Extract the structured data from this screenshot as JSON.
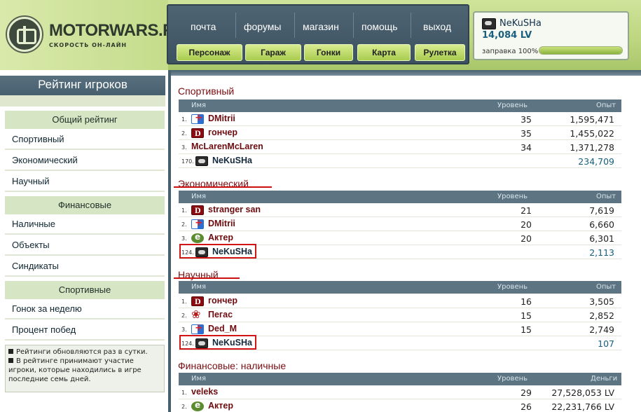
{
  "brand": {
    "name": "MOTORWARS.RU",
    "tagline": "СКОРОСТЬ ОН-ЛАЙН"
  },
  "topnav": {
    "links": [
      "почта",
      "форумы",
      "магазин",
      "помощь",
      "выход"
    ],
    "buttons": [
      "Персонаж",
      "Гараж",
      "Гонки",
      "Карта",
      "Рулетка"
    ]
  },
  "user": {
    "name": "NeKuSHa",
    "lv": "14,084 LV",
    "fuel_label": "заправка 100%",
    "fuel_percent": 100,
    "avatar_icon": "mask-icon"
  },
  "left": {
    "title": "Рейтинг игроков",
    "sections": [
      {
        "title": "Общий рейтинг",
        "items": [
          "Спортивный",
          "Экономический",
          "Научный"
        ]
      },
      {
        "title": "Финансовые",
        "items": [
          "Наличные",
          "Объекты",
          "Синдикаты"
        ]
      },
      {
        "title": "Спортивные",
        "items": [
          "Гонок за неделю",
          "Процент побед"
        ]
      }
    ],
    "notes": [
      "Рейтинги обновляются раз в сутки.",
      "В рейтинге принимают участие игроки, которые находились в игре последние семь дней."
    ]
  },
  "columns": {
    "name": "Имя",
    "level": "Уровень",
    "exp": "Опыт",
    "money": "Деньги"
  },
  "colors": {
    "accent": "#47606f",
    "title_red": "#7b0c10",
    "highlight_red": "#d21414"
  },
  "sections": [
    {
      "title": "Спортивный",
      "rows": [
        {
          "rank": "1.",
          "icon": "flag-icon",
          "name": "DMitrii",
          "level": "35",
          "value": "1,595,471"
        },
        {
          "rank": "2.",
          "icon": "d-icon",
          "name": "гончер",
          "level": "35",
          "value": "1,455,022"
        },
        {
          "rank": "3.",
          "icon": "",
          "name": "McLarenMcLaren",
          "level": "34",
          "value": "1,371,278"
        },
        {
          "rank": "170.",
          "icon": "mask-icon",
          "name": "NeKuSHa",
          "level": "",
          "value": "234,709"
        }
      ]
    },
    {
      "title": "Экономический",
      "rows": [
        {
          "rank": "1.",
          "icon": "d-icon",
          "name": "stranger san",
          "level": "21",
          "value": "7,619"
        },
        {
          "rank": "2.",
          "icon": "flag-icon",
          "name": "DMitrii",
          "level": "20",
          "value": "6,660"
        },
        {
          "rank": "3.",
          "icon": "eye-icon",
          "name": "Актер",
          "level": "20",
          "value": "6,301"
        },
        {
          "rank": "124.",
          "icon": "mask-icon",
          "name": "NeKuSHa",
          "level": "",
          "value": "2,113"
        }
      ]
    },
    {
      "title": "Научный",
      "rows": [
        {
          "rank": "1.",
          "icon": "d-icon",
          "name": "гончер",
          "level": "16",
          "value": "3,505"
        },
        {
          "rank": "2.",
          "icon": "bird-icon",
          "name": "Пегас",
          "level": "15",
          "value": "2,852"
        },
        {
          "rank": "3.",
          "icon": "flag-icon",
          "name": "Ded_M",
          "level": "15",
          "value": "2,749"
        },
        {
          "rank": "124.",
          "icon": "mask-icon",
          "name": "NeKuSHa",
          "level": "",
          "value": "107"
        }
      ]
    },
    {
      "title": "Финансовые: наличные",
      "rows": [
        {
          "rank": "1.",
          "icon": "",
          "name": "veleks",
          "level": "29",
          "value": "27,528,053 LV"
        },
        {
          "rank": "2.",
          "icon": "eye-icon",
          "name": "Актер",
          "level": "26",
          "value": "22,231,766 LV"
        }
      ]
    }
  ]
}
